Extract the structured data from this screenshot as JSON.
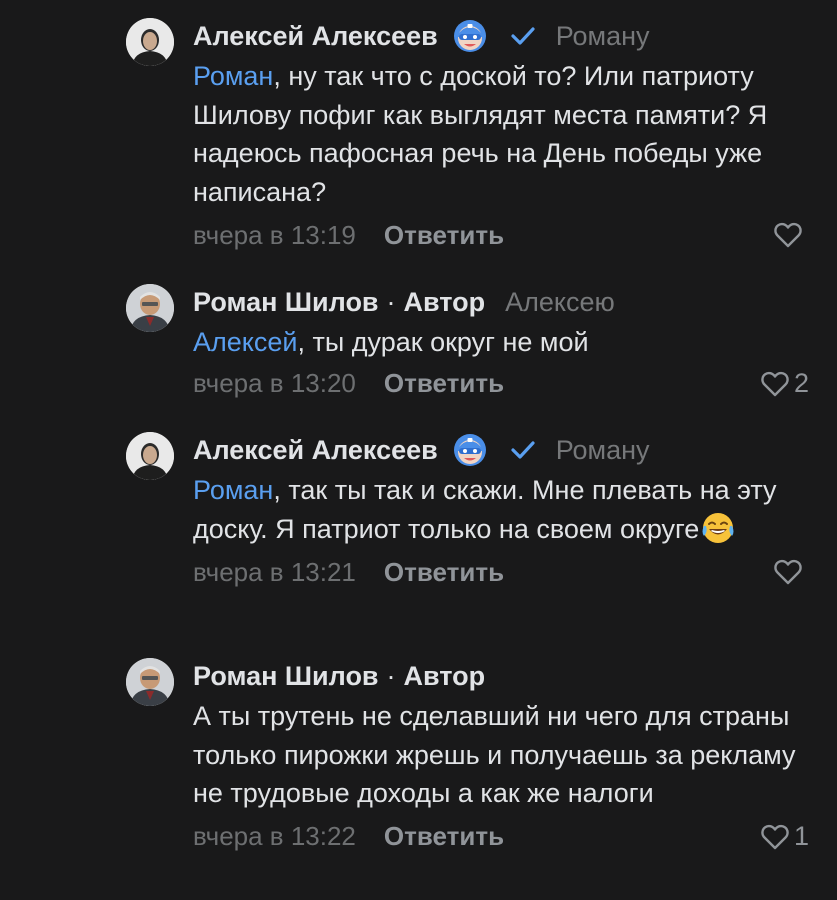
{
  "comments": [
    {
      "author": "Алексей Алексеев",
      "reply_to": "Роману",
      "mention": "Роман",
      "text": ", ну так что с доской то? Или патриоту Шилову пофиг как выглядят места памяти? Я надеюсь пафосная речь на День победы уже написана?",
      "time": "вчера в 13:19",
      "reply_label": "Ответить",
      "likes": ""
    },
    {
      "author": "Роман Шилов",
      "separator": "·",
      "role": "Автор",
      "reply_to": "Алексею",
      "mention": "Алексей",
      "text": ", ты дурак округ не мой",
      "time": "вчера в 13:20",
      "reply_label": "Ответить",
      "likes": "2"
    },
    {
      "author": "Алексей Алексеев",
      "reply_to": "Роману",
      "mention": "Роман",
      "text": ", так ты так и скажи. Мне плевать на эту доску. Я патриот только на своем округе",
      "time": "вчера в 13:21",
      "reply_label": "Ответить",
      "likes": ""
    },
    {
      "author": "Роман Шилов",
      "separator": "·",
      "role": "Автор",
      "text": "А ты трутень не сделавший ни чего для страны только пирожки жрешь и получаешь за рекламу не трудовые доходы а как же налоги",
      "time": "вчера в 13:22",
      "reply_label": "Ответить",
      "likes": "1"
    }
  ],
  "colors": {
    "background": "#19191a",
    "text": "#e1e3e6",
    "mention": "#5a9ff0",
    "secondary": "#76787a",
    "verified": "#5a9ff0"
  },
  "icons": {
    "badge": "superhero-mask-badge-icon",
    "verified": "check-icon",
    "like": "heart-outline-icon",
    "emoji": "tears-of-joy-emoji"
  }
}
